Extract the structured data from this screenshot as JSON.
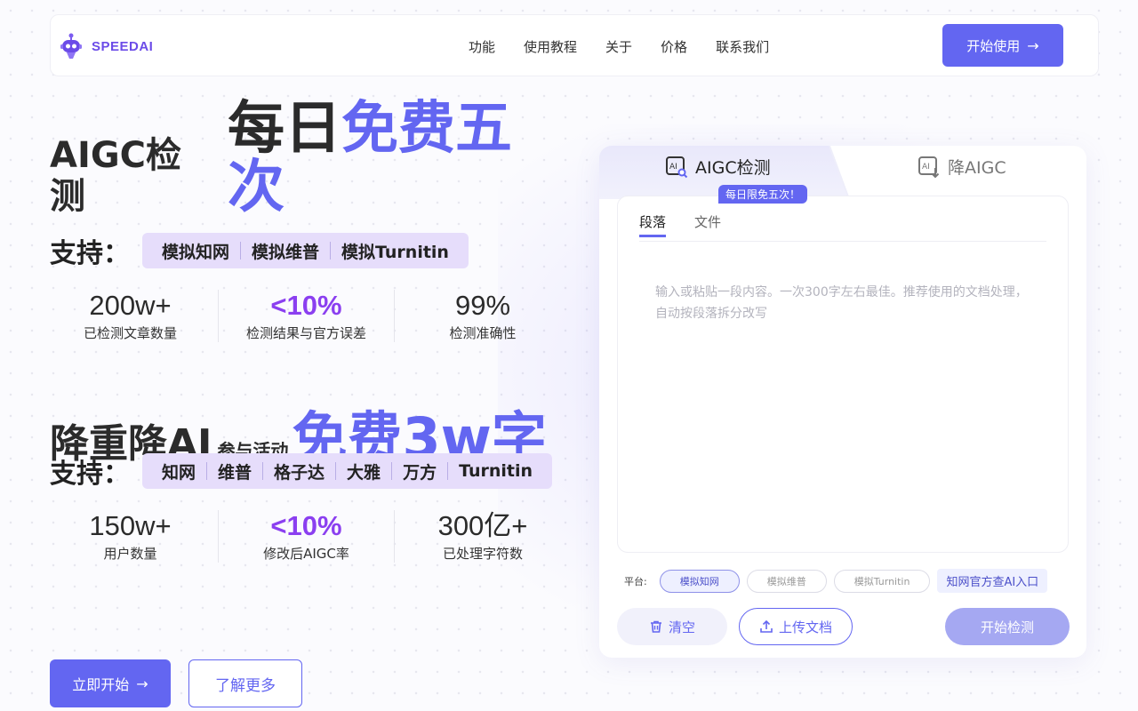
{
  "brand": {
    "name": "SPEEDAI",
    "color": "#6b4be8"
  },
  "colors": {
    "accent": "#6366f1",
    "highlight": "#8b3ff0",
    "chip_bg": "#e6ddfb"
  },
  "nav": {
    "items": [
      "功能",
      "使用教程",
      "关于",
      "价格",
      "联系我们"
    ],
    "cta_label": "开始使用",
    "cta_arrow": "→"
  },
  "hero_aigc": {
    "title_line1": "AIGC检",
    "title_line2": "测",
    "slogan_dark": "每日",
    "slogan_violet_1": "免费五",
    "slogan_violet_2": "次",
    "support_label": "支持：",
    "chips": [
      "模拟知网",
      "模拟维普",
      "模拟Turnitin"
    ],
    "stats": [
      {
        "value": "200w+",
        "label": "已检测文章数量"
      },
      {
        "value": "<10%",
        "label": "检测结果与官方误差"
      },
      {
        "value": "99%",
        "label": "检测准确性"
      }
    ]
  },
  "hero_reduce": {
    "title": "降重降AI",
    "sub": "参与活动",
    "big": "免费3w字",
    "support_label": "支持：",
    "chips": [
      "知网",
      "维普",
      "格子达",
      "大雅",
      "万方",
      "Turnitin"
    ],
    "stats": [
      {
        "value": "150w+",
        "label": "用户数量"
      },
      {
        "value": "<10%",
        "label": "修改后AIGC率"
      },
      {
        "value": "300亿+",
        "label": "已处理字符数"
      }
    ]
  },
  "buttons": {
    "start": "立即开始",
    "start_arrow": "→",
    "more": "了解更多"
  },
  "panel": {
    "tabs": {
      "active": "AIGC检测",
      "inactive": "降AIGC"
    },
    "badge": "每日限免五次！",
    "subtabs": [
      "段落",
      "文件"
    ],
    "input_placeholder": "输入或粘贴一段内容。一次300字左右最佳。推荐使用的文档处理，自动按段落拆分改写",
    "platform_label": "平台:",
    "platforms": [
      "模拟知网",
      "模拟维普",
      "模拟Turnitin"
    ],
    "platform_selected": "模拟知网",
    "official_link": "知网官方查AI入口",
    "clear_label": "清空",
    "upload_label": "上传文档",
    "detect_label": "开始检测"
  }
}
